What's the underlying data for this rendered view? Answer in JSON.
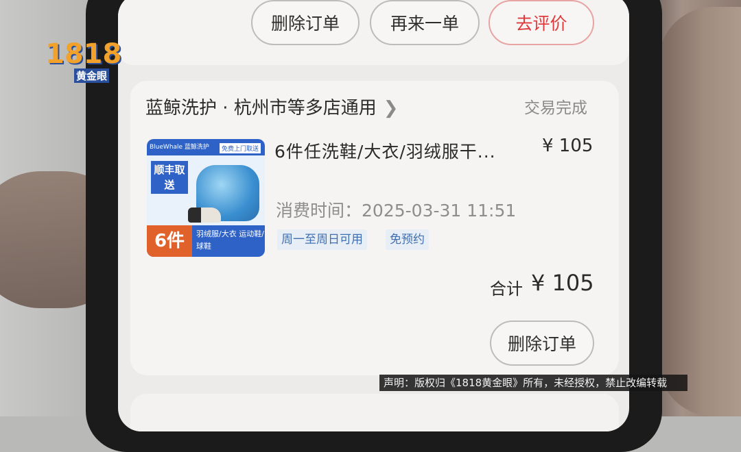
{
  "top_actions": {
    "delete_label": "删除订单",
    "reorder_label": "再来一单",
    "review_label": "去评价"
  },
  "order": {
    "store_name": "蓝鲸洗护 · 杭州市等多店通用",
    "status": "交易完成",
    "product_title": "6件任洗鞋/大衣/羽绒服干...",
    "price": "¥ 105",
    "consume_time_label": "消费时间：",
    "consume_time": "2025-03-31 11:51",
    "tags": [
      "周一至周日可用",
      "免预约"
    ],
    "total_label": "合计",
    "total": "¥ 105",
    "delete_label": "删除订单"
  },
  "thumbnail": {
    "brand": "BlueWhale 蓝鲸洗护",
    "pickup": "免费上门取送",
    "sf": "顺丰取送",
    "count": "6件",
    "items": "羽绒服/大衣 运动鞋/球鞋"
  },
  "overlay": {
    "logo_number": "1818",
    "logo_name": "黄金眼",
    "disclaimer": "声明：版权归《1818黄金眼》所有，未经授权，禁止改编转载"
  },
  "colors": {
    "accent_red": "#e0393b",
    "tag_blue": "#3f6fb0"
  }
}
